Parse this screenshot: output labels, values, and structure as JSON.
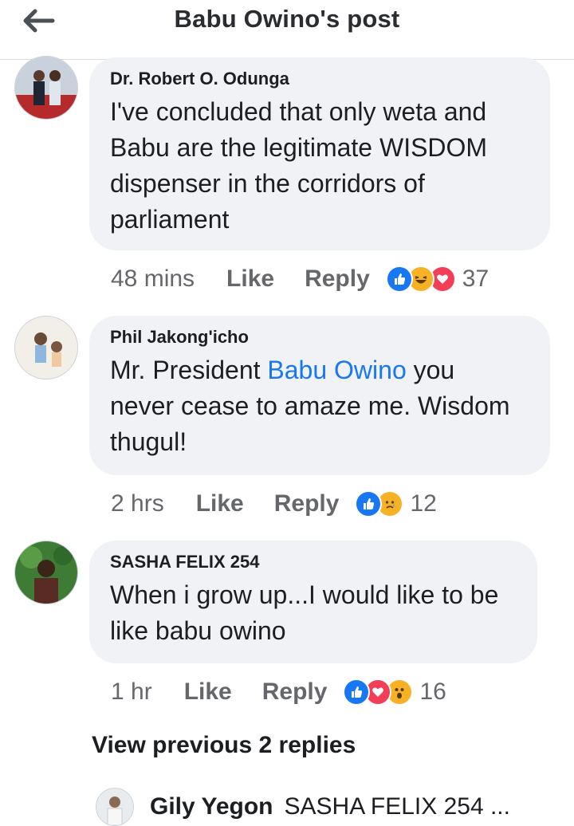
{
  "header": {
    "title": "Babu Owino's post"
  },
  "comments": [
    {
      "author": "Dr. Robert O. Odunga",
      "text": "I've concluded that only weta and\nBabu are the legitimate WISDOM\ndispenser in the corridors of\nparliament",
      "time": "48 mins",
      "like_label": "Like",
      "reply_label": "Reply",
      "reactions": [
        "like",
        "haha",
        "love"
      ],
      "count": "37"
    },
    {
      "author": "Phil Jakong'icho",
      "text_before": "Mr. President ",
      "mention": "Babu Owino",
      "text_after": " you\nnever cease to amaze me. Wisdom\nthugul!",
      "time": "2 hrs",
      "like_label": "Like",
      "reply_label": "Reply",
      "reactions": [
        "like",
        "sad"
      ],
      "count": "12"
    },
    {
      "author": "SASHA FELIX 254",
      "text": "When i grow up...I would like to be\nlike babu owino",
      "time": "1 hr",
      "like_label": "Like",
      "reply_label": "Reply",
      "reactions": [
        "like",
        "love",
        "wow"
      ],
      "count": "16"
    }
  ],
  "view_previous": "View previous 2 replies",
  "reply_preview": {
    "author": "Gily Yegon",
    "snippet": "SASHA FELIX 254 ..."
  },
  "colors": {
    "like": "#1877f2",
    "love": "#f33e58",
    "haha": "#f7b125",
    "link": "#1877f2"
  }
}
